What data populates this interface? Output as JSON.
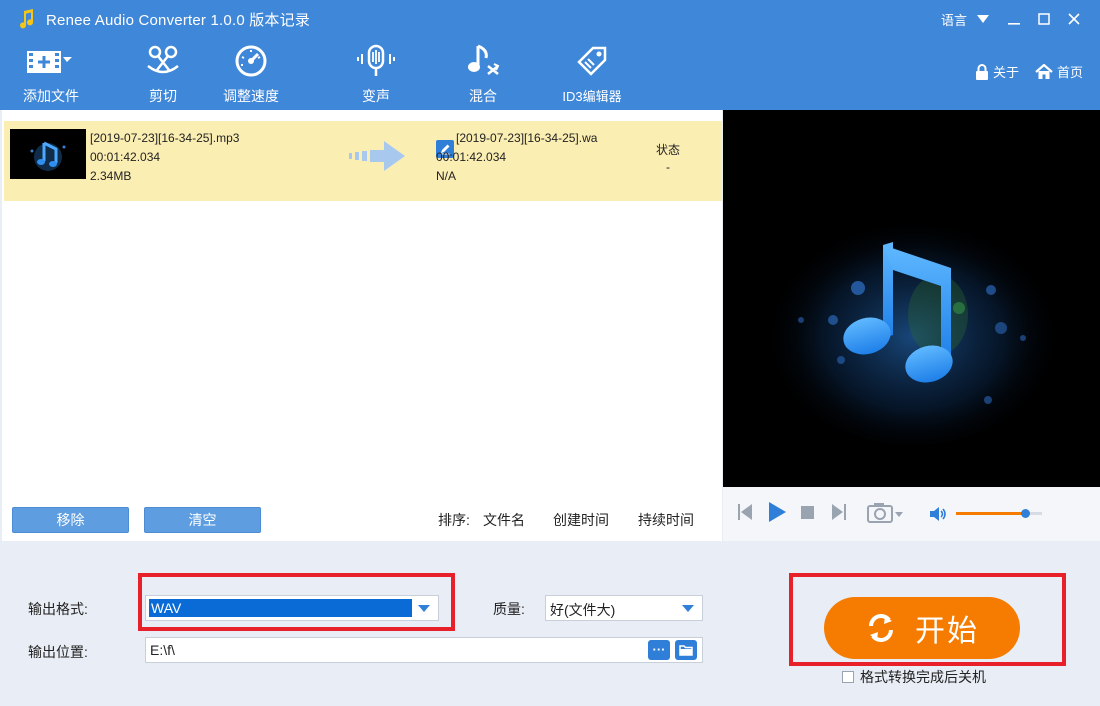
{
  "window": {
    "title": "Renee Audio Converter 1.0.0 版本记录",
    "language_label": "语言"
  },
  "toolbar": {
    "add_file": "添加文件",
    "cut": "剪切",
    "speed": "调整速度",
    "voice": "变声",
    "mix": "混合",
    "id3": "ID3编辑器",
    "about": "关于",
    "home": "首页"
  },
  "file_list": {
    "source": {
      "name": "[2019-07-23][16-34-25].mp3",
      "duration": "00:01:42.034",
      "size": "2.34MB"
    },
    "target": {
      "name": "[2019-07-23][16-34-25].wa",
      "duration": "00:01:42.034",
      "size": "N/A"
    },
    "status_header": "状态",
    "status_value": "-"
  },
  "list_actions": {
    "remove": "移除",
    "clear": "清空",
    "sort_label": "排序:",
    "sort_name": "文件名",
    "sort_created": "创建时间",
    "sort_duration": "持续时间"
  },
  "settings": {
    "format_label": "输出格式:",
    "format_value": "WAV",
    "quality_label": "质量:",
    "quality_value": "好(文件大)",
    "output_label": "输出位置:",
    "output_path": "E:\\f\\",
    "browse_dots": "···"
  },
  "actions": {
    "start": "开始",
    "shutdown": "格式转换完成后关机"
  },
  "colors": {
    "titlebar": "#3f87d8",
    "accent": "#2f7fd8",
    "start_button": "#f57c00",
    "highlight_row": "#fbeeb3",
    "selection": "#0a6bd6",
    "annotation_red": "#e8202a",
    "volume": "#f57c00"
  },
  "player": {
    "volume_level": 0.8
  }
}
